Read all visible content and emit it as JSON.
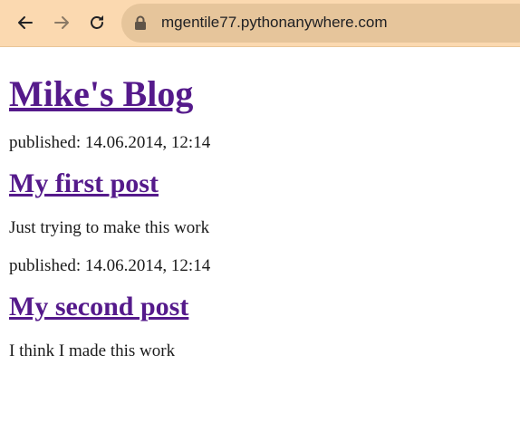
{
  "browser": {
    "url": "mgentile77.pythonanywhere.com"
  },
  "blog": {
    "title": "Mike's Blog",
    "posts": [
      {
        "published": "published: 14.06.2014, 12:14",
        "title": "My first post",
        "text": "Just trying to make this work"
      },
      {
        "published": "published: 14.06.2014, 12:14",
        "title": "My second post",
        "text": "I think I made this work"
      }
    ]
  },
  "colors": {
    "toolbar": "#fbd9b0",
    "omnibox": "#e6c59b",
    "link": "#551a8b"
  }
}
